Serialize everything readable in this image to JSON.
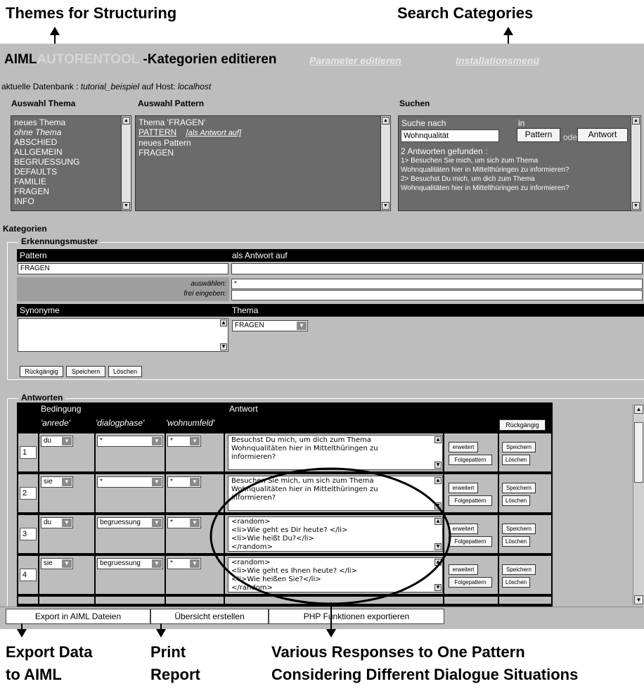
{
  "annotations": {
    "themes": "Themes for Structuring",
    "search": "Search  Categories",
    "export": [
      "Export Data",
      "to AIML"
    ],
    "print": [
      "Print",
      "Report"
    ],
    "various": [
      "Various Responses to One Pattern",
      "Considering Different Dialogue Situations"
    ]
  },
  "header": {
    "title_prefix": "AIML",
    "title_ghost": "AUTORENTOOL",
    "title_main": " -Kategorien editieren",
    "link_params": "Parameter editieren",
    "link_install": "Installationsmenü"
  },
  "dbinfo": {
    "prefix": "aktuelle Datenbank : ",
    "db": "tutorial_beispiel",
    "mid": " auf Host: ",
    "host": "localhost"
  },
  "themes": {
    "label": "Auswahl Thema",
    "items": [
      "neues Thema",
      "ohne Thema",
      "ABSCHIED",
      "ALLGEMEIN",
      "BEGRUESSUNG",
      "DEFAULTS",
      "FAMILIE",
      "FRAGEN",
      "INFO"
    ]
  },
  "patterns": {
    "label": "Auswahl Pattern",
    "heading": "Thema 'FRAGEN'",
    "pattern_link": "PATTERN",
    "answer_link": "[als Antwort auf]",
    "items": [
      "neues Pattern",
      "FRAGEN"
    ]
  },
  "search": {
    "label": "Suchen",
    "search_for": "Suche nach",
    "in": "in",
    "value": "Wohnqualität",
    "btn_pattern": "Pattern",
    "or": "oder",
    "btn_answer": "Antwort",
    "found": "2 Antworten gefunden :",
    "results": [
      "1> Besuchen Sie mich, um sich zum Thema",
      "Wohnqualitäten hier in Mittelthüringen zu informieren?",
      "2> Besuchst Du mich, um dich zum Thema",
      "Wohnqualitäten hier in Mittelthüringen zu informieren?"
    ]
  },
  "kategorien": {
    "label": "Kategorien",
    "erkennung": "Erkennungsmuster",
    "pattern_hdr": "Pattern",
    "answer_hdr": "als Antwort auf",
    "pattern_value": "FRAGEN",
    "select_label": "auswählen:",
    "select_value": "*",
    "free_label": "frei eingeben:",
    "synonyme": "Synonyme",
    "thema": "Thema",
    "thema_value": "FRAGEN",
    "btn_undo": "Rückgängig",
    "btn_save": "Speichern",
    "btn_delete": "Löschen"
  },
  "antworten": {
    "label": "Antworten",
    "bedingung": "Bedingung",
    "cols": [
      "'anrede'",
      "'dialogphase'",
      "'wohnumfeld'"
    ],
    "antwort": "Antwort",
    "btn_undo": "Rückgängig",
    "btn_extended": "erweitert",
    "btn_follow": "Folgepattern",
    "btn_save": "Speichern",
    "btn_delete": "Löschen",
    "rows": [
      {
        "num": "1",
        "anrede": "du",
        "phase": "*",
        "wohn": "*",
        "text": "Besuchst Du mich, um dich zum Thema\nWohnqualitäten hier in Mittelthüringen zu\ninformieren?"
      },
      {
        "num": "2",
        "anrede": "sie",
        "phase": "*",
        "wohn": "*",
        "text": "Besuchen Sie mich, um sich zum Thema\nWohnqualitäten hier in Mittelthüringen zu\ninformieren?"
      },
      {
        "num": "3",
        "anrede": "du",
        "phase": "begruessung",
        "wohn": "*",
        "text": "<random>\n<li>Wie geht es Dir heute? </li>\n<li>Wie heißt Du?</li>\n</random>"
      },
      {
        "num": "4",
        "anrede": "sie",
        "phase": "begruessung",
        "wohn": "*",
        "text": "<random>\n<li>Wie geht es Ihnen heute? </li>\n<li>Wie heißen Sie?</li>\n</random>"
      }
    ]
  },
  "bottom_tabs": [
    "Export in AIML Dateien",
    "Übersicht erstellen",
    "PHP Funktionen exportieren"
  ]
}
